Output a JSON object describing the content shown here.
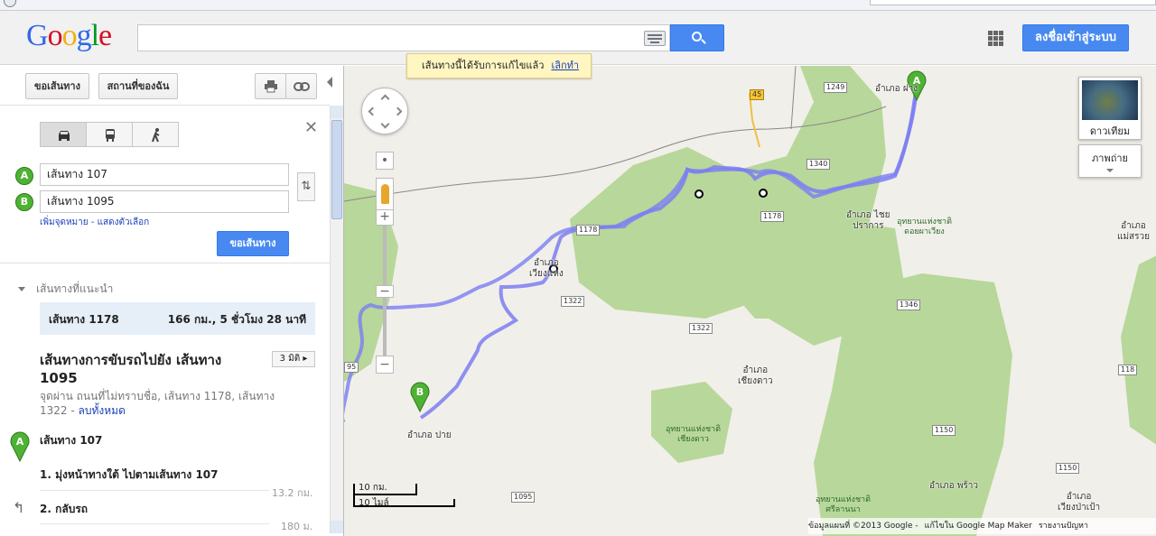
{
  "header": {
    "logo": [
      "G",
      "o",
      "o",
      "g",
      "l",
      "e"
    ],
    "search_value": "",
    "sign_in": "ลงชื่อเข้าสู่ระบบ"
  },
  "notice": {
    "text": "เส้นทางนี้ได้รับการแก้ไขแล้ว",
    "undo": "เลิกทำ"
  },
  "sidebar": {
    "buttons": {
      "directions": "ขอเส้นทาง",
      "my_places": "สถานที่ของฉัน"
    },
    "modes": [
      "car-icon",
      "transit-icon",
      "walk-icon"
    ],
    "waypoint_a": {
      "marker": "A",
      "value": "เส้นทาง 107"
    },
    "waypoint_b": {
      "marker": "B",
      "value": "เส้นทาง 1095"
    },
    "add_destination": "เพิ่มจุดหมาย - แสดงตัวเลือก",
    "get_directions": "ขอเส้นทาง",
    "suggested_label": "เส้นทางที่แนะนำ",
    "suggested_route": {
      "name": "เส้นทาง 1178",
      "detail": "166 กม., 5 ชั่วโมง 28 นาที"
    },
    "directions_title": "เส้นทางการขับรถไปยัง เส้นทาง 1095",
    "time_button": "3 มิติ ▸",
    "via": "จุดผ่าน ถนนที่ไม่ทราบชื่อ, เส้นทาง 1178, เส้นทาง 1322 -",
    "clear_all": "ลบทั้งหมด",
    "start_marker": "A",
    "start_name": "เส้นทาง 107",
    "steps": [
      {
        "text": "1. มุ่งหน้าทางใต้ ไปตามเส้นทาง 107",
        "distance": "13.2 กม."
      },
      {
        "text": "2. กลับรถ",
        "distance": "180 ม."
      }
    ]
  },
  "map": {
    "satellite_label": "ดาวเทียม",
    "photo_label": "ภาพถ่าย",
    "scale_km": "10 กม.",
    "scale_mi": "10 ไมล์",
    "marker_a": "A",
    "marker_b": "B",
    "places": {
      "fang": "อำเภอ ฝาง",
      "chai_prakan": "อำเภอ ไชย\nปราการ",
      "wiang_haeng": "อำเภอ\nเวียงแหง",
      "chiang_dao": "อำเภอ\nเชียงดาว",
      "pai": "อำเภอ ปาย",
      "phrao": "อำเภอ พร้าว",
      "mae_suai": "อำเภอ\nแม่สรวย",
      "wiang_pa_pao": "อำเภอ\nเวียงป่าเป้า"
    },
    "parks": {
      "pha_daeng": "อุทยานแห่งชาติ\nดอยผาเวียง",
      "chiang_dao_park": "อุทยานแห่งชาติ\nเชียงดาว",
      "sri_lanna": "อุทยานแห่งชาติ\nศรีลานนา"
    },
    "shields": {
      "r45": "45",
      "r1249": "1249",
      "r1340": "1340",
      "r1178a": "1178",
      "r1178b": "1178",
      "r1322a": "1322",
      "r1322b": "1322",
      "r1346": "1346",
      "r118": "118",
      "r1150a": "1150",
      "r1150b": "1150",
      "r1095": "1095",
      "r95": "95"
    },
    "footer": {
      "data": "ข้อมูลแผนที่ ©2013 Google -",
      "edit": "แก้ไขใน Google Map Maker",
      "report": "รายงานปัญหา"
    }
  },
  "colors": {
    "route": "#7b7ef2",
    "park": "#b8d79a",
    "accent": "#4889f1"
  }
}
